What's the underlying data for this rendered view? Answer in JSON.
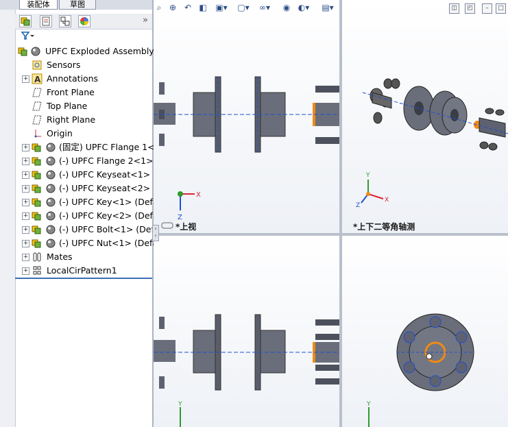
{
  "tabs": [
    "装配体",
    "草图"
  ],
  "panel_expand": "»",
  "filter_icon": "filter-icon",
  "tree": {
    "root": "UPFC Exploded Assembly",
    "items": [
      {
        "label": "Sensors",
        "icon": "sensor-icon",
        "expandable": false
      },
      {
        "label": "Annotations",
        "icon": "annotation-icon",
        "expandable": true
      },
      {
        "label": "Front Plane",
        "icon": "plane-icon",
        "expandable": false
      },
      {
        "label": "Top Plane",
        "icon": "plane-icon",
        "expandable": false
      },
      {
        "label": "Right Plane",
        "icon": "plane-icon",
        "expandable": false
      },
      {
        "label": "Origin",
        "icon": "origin-icon",
        "expandable": false
      },
      {
        "label": "(固定) UPFC Flange 1<1",
        "icon": "part-icon",
        "expandable": true
      },
      {
        "label": "(-) UPFC Flange 2<1> (D",
        "icon": "part-icon",
        "expandable": true
      },
      {
        "label": "(-) UPFC Keyseat<1> (D",
        "icon": "part-icon",
        "expandable": true
      },
      {
        "label": "(-) UPFC Keyseat<2> (D",
        "icon": "part-icon",
        "expandable": true
      },
      {
        "label": "(-) UPFC Key<1> (Defau",
        "icon": "part-icon",
        "expandable": true
      },
      {
        "label": "(-) UPFC Key<2> (Defau",
        "icon": "part-icon",
        "expandable": true
      },
      {
        "label": "(-) UPFC Bolt<1> (Defau",
        "icon": "part-icon",
        "expandable": true
      },
      {
        "label": "(-) UPFC Nut<1> (Defau",
        "icon": "part-icon",
        "expandable": true
      },
      {
        "label": "Mates",
        "icon": "mates-icon",
        "expandable": true
      },
      {
        "label": "LocalCirPattern1",
        "icon": "pattern-icon",
        "expandable": true
      }
    ]
  },
  "viewports": {
    "top_left_label": "*上视",
    "top_right_label": "*上下二等角轴测"
  },
  "triad": {
    "x": "X",
    "y": "Y",
    "z": "Z"
  },
  "colors": {
    "accent_orange": "#f08a16",
    "part_gray": "#5e6270",
    "axis_blue": "#1f4fd1",
    "selection_blue": "#3a6fb4"
  }
}
